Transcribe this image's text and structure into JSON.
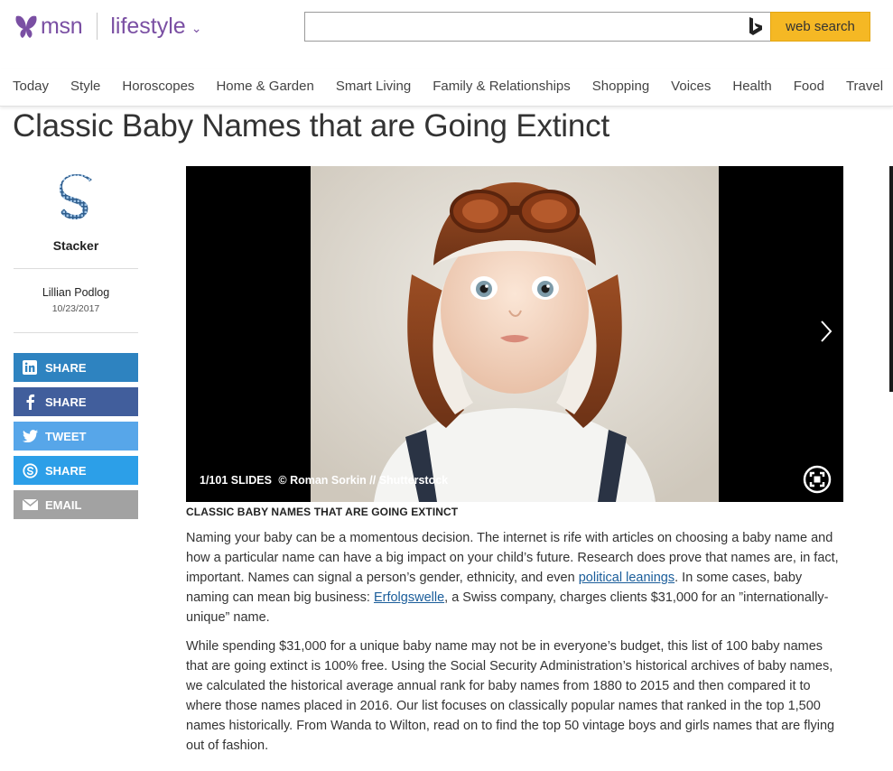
{
  "header": {
    "logo_text": "msn",
    "section": "lifestyle",
    "search": {
      "value": "",
      "placeholder": ""
    },
    "search_button": "web search"
  },
  "nav": {
    "items": [
      "Today",
      "Style",
      "Horoscopes",
      "Home & Garden",
      "Smart Living",
      "Family & Relationships",
      "Shopping",
      "Voices",
      "Health",
      "Food",
      "Travel"
    ]
  },
  "article": {
    "title": "Classic Baby Names that are Going Extinct",
    "source": "Stacker",
    "author": "Lillian Podlog",
    "date": "10/23/2017"
  },
  "share": {
    "linkedin": "SHARE",
    "facebook": "SHARE",
    "twitter": "TWEET",
    "skype": "SHARE",
    "email": "EMAIL"
  },
  "slideshow": {
    "counter": "1/101 SLIDES",
    "credit": "© Roman Sorkin // Shutterstock",
    "caption_title": "CLASSIC BABY NAMES THAT ARE GOING EXTINCT"
  },
  "body": {
    "p1_a": "Naming your baby can be a momentous decision. The internet is rife with articles on choosing a baby name and how a particular name can have a big impact on your child’s future. Research does prove that names are, in fact, important. Names can signal a person’s gender, ethnicity, and even ",
    "p1_link1": "political leanings",
    "p1_b": ". In some cases, baby naming can mean big business: ",
    "p1_link2": "Erfolgswelle",
    "p1_c": ", a Swiss company, charges clients $31,000 for an ”internationally-unique” name.",
    "p2": "While spending $31,000 for a unique baby name may not be in everyone’s budget, this list of 100 baby names that are going extinct is 100% free. Using the Social Security Administration’s historical archives of baby names, we calculated the historical average annual rank for baby names from 1880 to 2015 and then compared it to where those names placed in 2016. Our list focuses on classically popular names that ranked in the top 1,500 names historically. From Wanda to Wilton, read on to find the top 50 vintage boys and girls names that are flying out of fashion."
  },
  "colors": {
    "brand": "#7a4fa3",
    "search_button": "#f5b824",
    "linkedin": "#2e83c0",
    "facebook": "#415e9c",
    "twitter": "#57a6e9",
    "skype": "#2c9fe8",
    "email": "#a2a2a2",
    "link": "#1a5d9a"
  }
}
